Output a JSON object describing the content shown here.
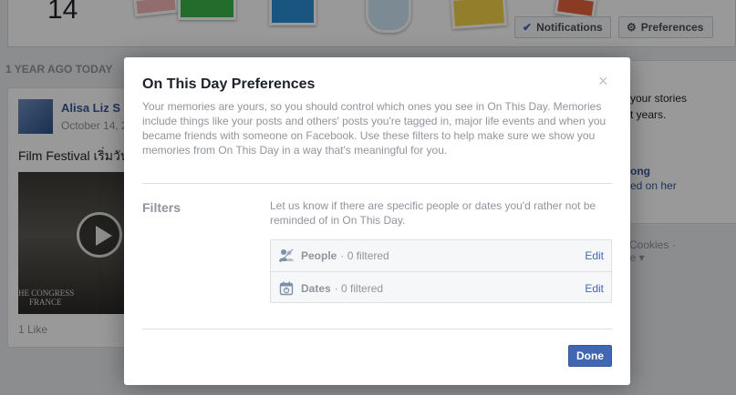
{
  "background": {
    "day_number": "14",
    "notifications_label": "Notifications",
    "preferences_label": "Preferences",
    "section_heading": "1 YEAR AGO TODAY",
    "post": {
      "author": "Alisa Liz S",
      "date": "October 14, 2",
      "text": "Film Festival เริ่มวัน",
      "video_caption_1": "HE CONGRESS",
      "video_caption_2": "FRANCE",
      "likes": "1 Like"
    },
    "right_card": {
      "line1": "your stories",
      "line2": "t years.",
      "line3": "ong",
      "line4": "ed on her"
    },
    "footer": {
      "line1": "Cookies ·",
      "line2": "ore ▾"
    }
  },
  "dialog": {
    "title": "On This Day Preferences",
    "close_glyph": "×",
    "description": "Your memories are yours, so you should control which ones you see in On This Day. Memories include things like your posts and others' posts you're tagged in, major life events and when you became friends with someone on Facebook. Use these filters to help make sure we show you memories from On This Day in a way that's meaningful for you.",
    "filters_label": "Filters",
    "filters_help": "Let us know if there are specific people or dates you'd rather not be reminded of in On This Day.",
    "filters": [
      {
        "icon": "people-icon",
        "name": "People",
        "count": "· 0 filtered",
        "edit": "Edit"
      },
      {
        "icon": "calendar-icon",
        "name": "Dates",
        "count": "· 0 filtered",
        "edit": "Edit"
      }
    ],
    "done_label": "Done"
  },
  "colors": {
    "accent": "#4267b2",
    "link": "#365899",
    "muted_text": "#90949c",
    "overlay": "rgba(0,0,0,0.40)"
  }
}
